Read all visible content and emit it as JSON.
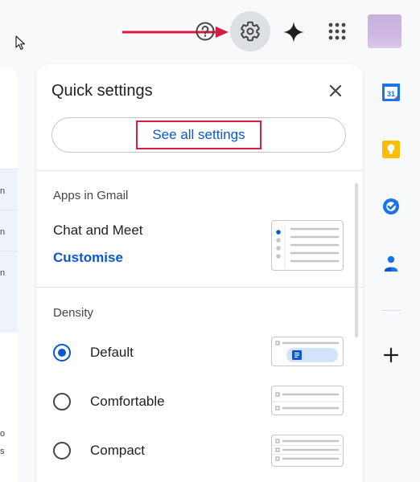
{
  "topbar": {
    "help_icon": "help-circle-icon",
    "settings_icon": "gear-icon",
    "gemini_icon": "sparkle-icon",
    "apps_icon": "apps-grid-icon",
    "annotation_arrow_color": "#d81b3f"
  },
  "left_panel": {
    "row_fragments": [
      "n",
      "n",
      "n",
      "o",
      "s"
    ]
  },
  "quick_settings": {
    "title": "Quick settings",
    "see_all_label": "See all settings",
    "apps_section": {
      "heading": "Apps in Gmail",
      "chat_label": "Chat and Meet",
      "customise_label": "Customise"
    },
    "density_section": {
      "heading": "Density",
      "options": [
        {
          "label": "Default",
          "selected": true
        },
        {
          "label": "Comfortable",
          "selected": false
        },
        {
          "label": "Compact",
          "selected": false
        }
      ]
    }
  },
  "side_rail": {
    "apps": [
      {
        "name": "Calendar",
        "icon": "calendar-icon",
        "text": "31"
      },
      {
        "name": "Keep",
        "icon": "keep-icon"
      },
      {
        "name": "Tasks",
        "icon": "tasks-icon"
      },
      {
        "name": "Contacts",
        "icon": "contacts-icon"
      }
    ],
    "add_icon": "plus-icon"
  },
  "colors": {
    "accent": "#0b57d0",
    "highlight": "#d81b3f",
    "calendar": "#1a73e8",
    "keep": "#fbbc04"
  }
}
